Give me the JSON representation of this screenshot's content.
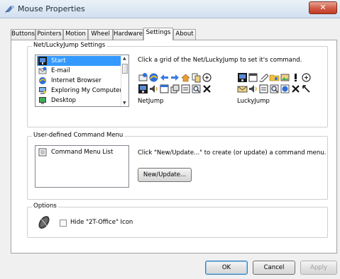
{
  "window": {
    "title": "Mouse Properties",
    "close_label": "✕"
  },
  "tabs": [
    {
      "label": "Buttons"
    },
    {
      "label": "Pointers"
    },
    {
      "label": "Motion"
    },
    {
      "label": "Wheel"
    },
    {
      "label": "Hardware"
    },
    {
      "label": "Settings",
      "active": true
    },
    {
      "label": "About"
    }
  ],
  "netlucky": {
    "legend": "Net/LuckyJump Settings",
    "items": [
      {
        "label": "Start",
        "icon": "start-icon",
        "selected": true
      },
      {
        "label": "E-mail",
        "icon": "email-icon"
      },
      {
        "label": "Internet Browser",
        "icon": "internet-browser-icon"
      },
      {
        "label": "Exploring My Computer",
        "icon": "my-computer-icon"
      },
      {
        "label": "Desktop",
        "icon": "desktop-icon"
      }
    ],
    "instruction": "Click a grid of the Net/LuckyJump to set it's command.",
    "netjump_label": "NetJump",
    "luckyjump_label": "LuckyJump"
  },
  "command_menu": {
    "legend": "User-defined Command Menu",
    "list_items": [
      {
        "label": "Command Menu List",
        "icon": "command-list-icon"
      }
    ],
    "instruction": "Click \"New/Update...\" to create (or update) a command menu.",
    "new_update_label": "New/Update..."
  },
  "options": {
    "legend": "Options",
    "hide_icon_label": "Hide \"2T-Office\" Icon",
    "hide_icon_checked": false
  },
  "footer": {
    "ok_label": "OK",
    "cancel_label": "Cancel",
    "apply_label": "Apply"
  },
  "colors": {
    "selection": "#3399ff",
    "accent_blue": "#2f6fd6",
    "close_red": "#c43a24"
  }
}
